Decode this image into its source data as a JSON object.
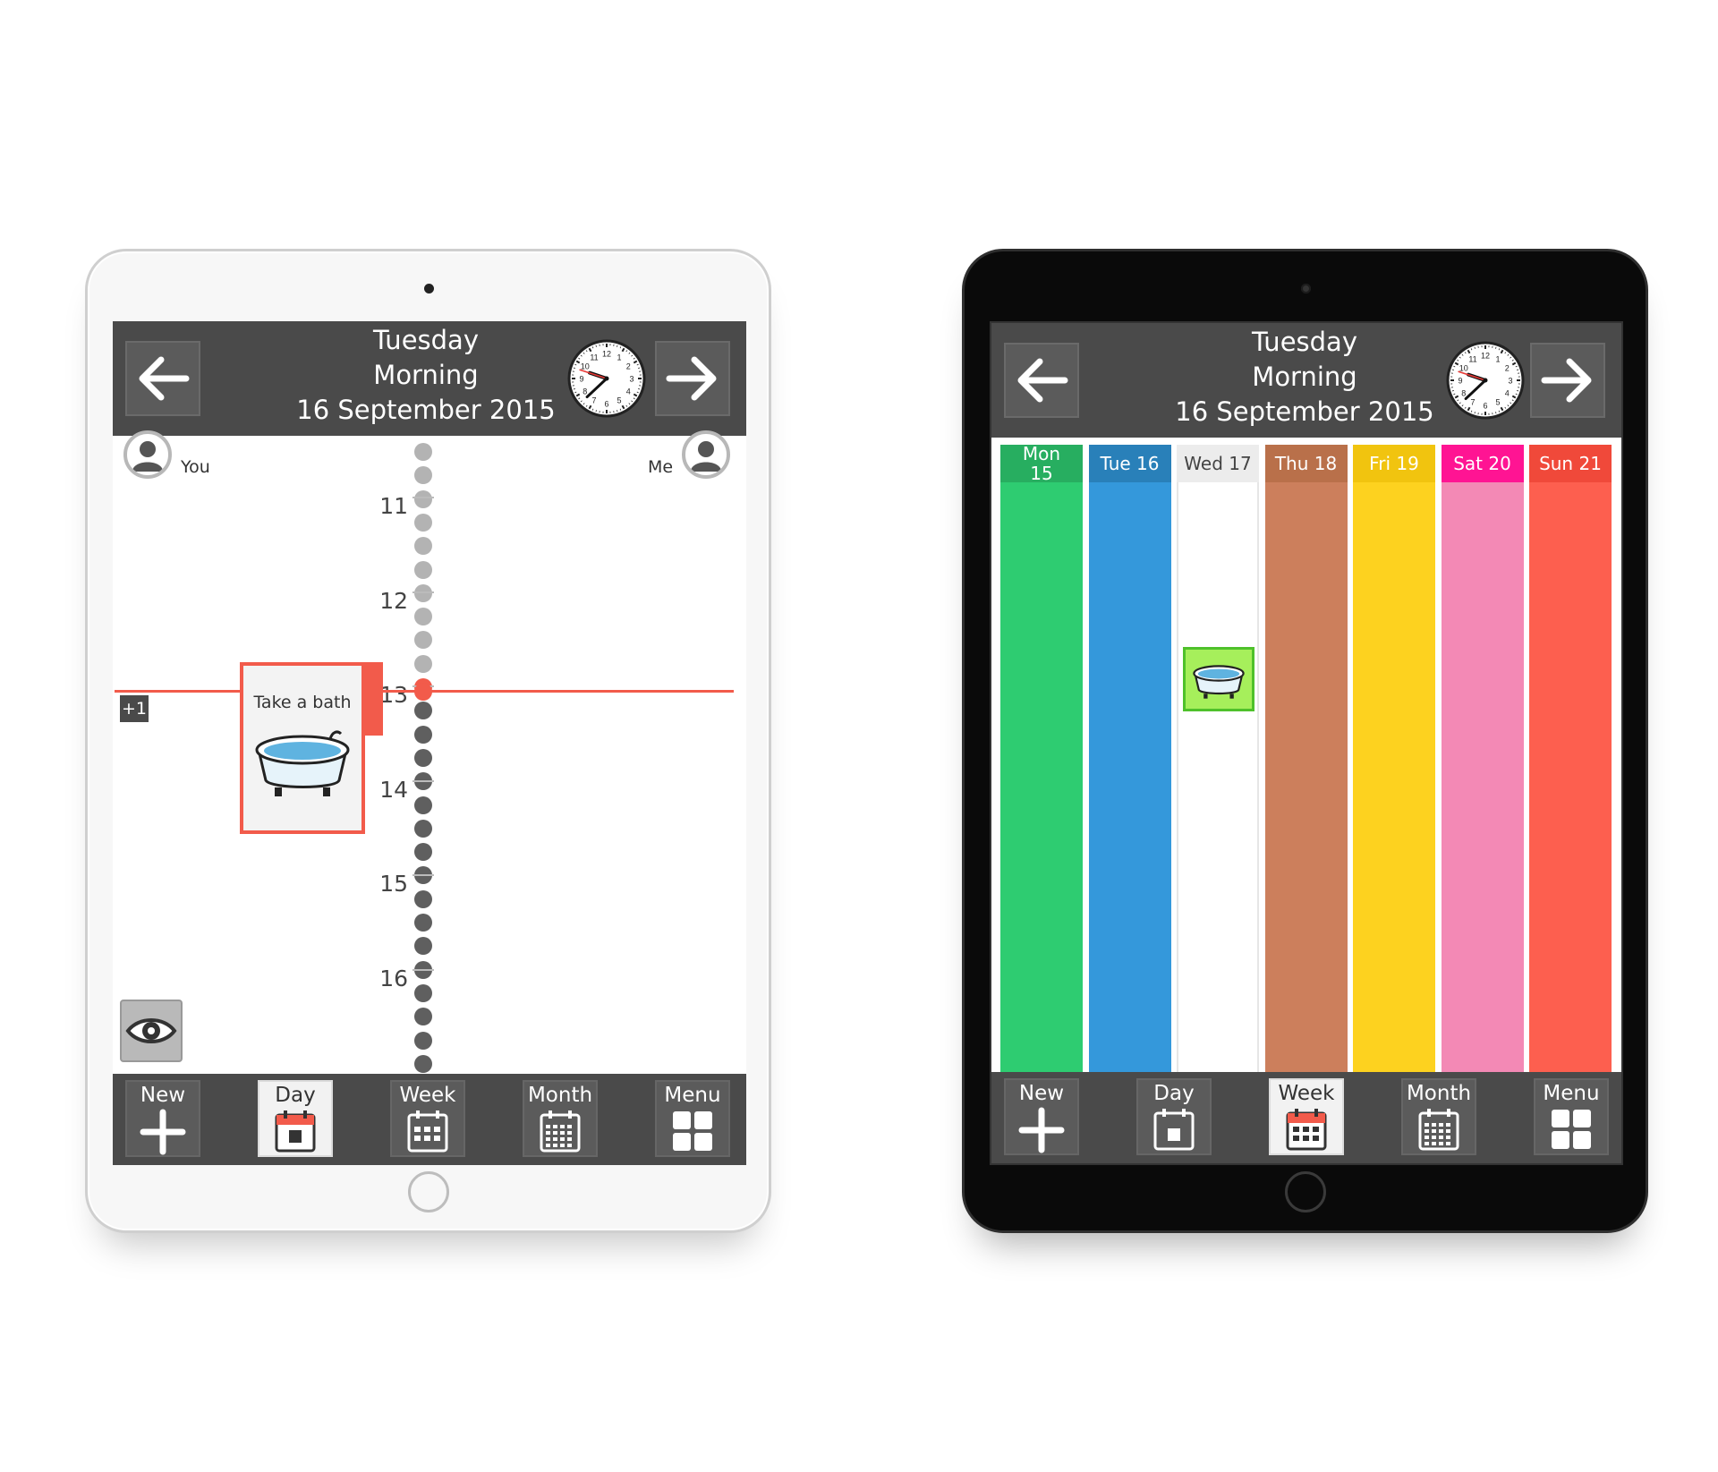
{
  "header": {
    "day": "Tuesday",
    "period": "Morning",
    "date": "16 September 2015"
  },
  "clock": {
    "numbers": [
      "12",
      "1",
      "2",
      "3",
      "4",
      "5",
      "6",
      "7",
      "8",
      "9",
      "10",
      "11"
    ],
    "hour": 9,
    "minute": 37,
    "second": 48
  },
  "toolbar": {
    "new_label": "New",
    "day_label": "Day",
    "week_label": "Week",
    "month_label": "Month",
    "menu_label": "Menu"
  },
  "day_view": {
    "left_person": "You",
    "right_person": "Me",
    "hours": [
      "11",
      "12",
      "13",
      "14",
      "15",
      "16"
    ],
    "extra_badge": "+1",
    "event": {
      "title": "Take a bath",
      "icon": "bathtub-icon"
    },
    "active_tab": "Day"
  },
  "week_view": {
    "days": [
      {
        "label": "Mon 15",
        "head_color": "#27ae60",
        "body_color": "#2ecc71"
      },
      {
        "label": "Tue 16",
        "head_color": "#2980b9",
        "body_color": "#3498db"
      },
      {
        "label": "Wed 17",
        "head_color": "#ececec",
        "body_color": "#ffffff"
      },
      {
        "label": "Thu 18",
        "head_color": "#b9704a",
        "body_color": "#cc7f5c"
      },
      {
        "label": "Fri 19",
        "head_color": "#f1c40f",
        "body_color": "#fdd21f"
      },
      {
        "label": "Sat 20",
        "head_color": "#ff1493",
        "body_color": "#f389b5"
      },
      {
        "label": "Sun 21",
        "head_color": "#f0493a",
        "body_color": "#fd5f4f"
      }
    ],
    "event_icon": "bathtub-icon",
    "active_tab": "Week"
  },
  "colors": {
    "bar": "#4a4a4a",
    "now_line": "#f25b4b",
    "event_border": "#f25b4b",
    "week_event_bg": "#a6ef5b",
    "week_event_border": "#4fc12b"
  }
}
